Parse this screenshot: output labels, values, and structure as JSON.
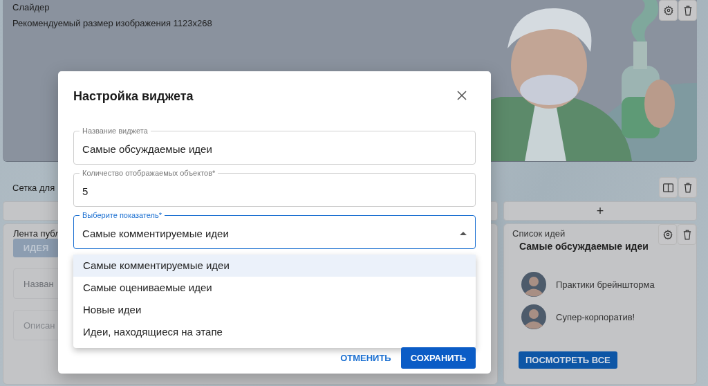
{
  "slider": {
    "title": "Слайдер",
    "hint": "Рекомендуемый размер изображения 1123x268"
  },
  "grid": {
    "title": "Сетка для",
    "add_label": "+"
  },
  "feed_widget": {
    "title": "Лента публ",
    "button": "ИДЕЯ",
    "fields": [
      {
        "placeholder": "Назван"
      },
      {
        "placeholder": "Описан"
      }
    ]
  },
  "ideas_widget": {
    "label": "Список идей",
    "title": "Самые обсуждаемые идеи",
    "items": [
      {
        "title": "Практики брейншторма"
      },
      {
        "title": "Супер-корпоратив!"
      }
    ],
    "button": "ПОСМОТРЕТЬ ВСЕ"
  },
  "dialog": {
    "title": "Настройка виджета",
    "fields": [
      {
        "kind": "text",
        "label": "Название виджета",
        "value": "Самые обсуждаемые идеи",
        "focused": false
      },
      {
        "kind": "text",
        "label": "Количество отображаемых объектов*",
        "value": "5",
        "focused": false
      },
      {
        "kind": "select",
        "label": "Выберите показатель*",
        "value": "Самые комментируемые идеи",
        "focused": true,
        "expanded": true,
        "options": [
          {
            "label": "Самые комментируемые идеи",
            "selected": true
          },
          {
            "label": "Самые оцениваемые идеи",
            "selected": false
          },
          {
            "label": "Новые идеи",
            "selected": false
          },
          {
            "label": "Идеи, находящиеся на этапе",
            "selected": false
          }
        ]
      }
    ],
    "buttons": [
      {
        "kind": "text",
        "label": "ОТМЕНИТЬ"
      },
      {
        "kind": "primary",
        "label": "СОХРАНИТЬ"
      }
    ]
  }
}
